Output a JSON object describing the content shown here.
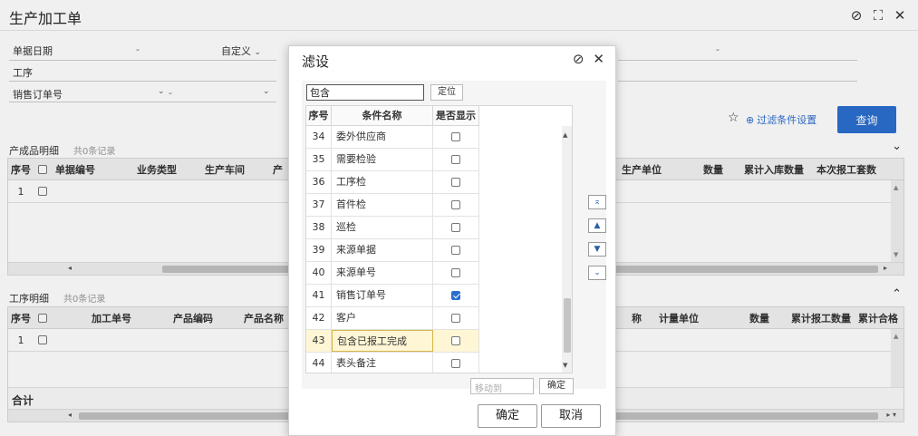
{
  "window": {
    "title": "生产加工单",
    "help_icon": "help-circle-icon",
    "maximize_icon": "maximize-icon",
    "close_icon": "close-icon"
  },
  "filters": {
    "doc_date_label": "单据日期",
    "doc_date_dash": "-",
    "custom_label": "自定义",
    "process_label": "工序",
    "sales_order_label": "销售订单号",
    "sales_order_dash": "-",
    "right_dash": "-",
    "filter_settings_label": "过滤条件设置",
    "query_label": "查询"
  },
  "products": {
    "title": "产成品明细",
    "count": "共0条记录",
    "columns": [
      "序号",
      "单据编号",
      "业务类型",
      "生产车间",
      "产"
    ],
    "right_columns": [
      "生产单位",
      "数量",
      "累计入库数量",
      "本次报工套数"
    ],
    "rows": [
      {
        "no": "1"
      }
    ]
  },
  "process_detail": {
    "title": "工序明细",
    "count": "共0条记录",
    "columns": [
      "序号",
      "加工单号",
      "产品编码",
      "产品名称"
    ],
    "right_columns": [
      "称",
      "计量单位",
      "数量",
      "累计报工数量",
      "累计合格"
    ],
    "rows": [
      {
        "no": "1"
      }
    ],
    "total_label": "合计"
  },
  "dialog": {
    "title": "滤设",
    "search_value": "包含",
    "locate_label": "定位",
    "columns": {
      "no": "序号",
      "name": "条件名称",
      "show": "是否显示"
    },
    "rows": [
      {
        "no": "34",
        "name": "委外供应商",
        "checked": false
      },
      {
        "no": "35",
        "name": "需要检验",
        "checked": false
      },
      {
        "no": "36",
        "name": "工序检",
        "checked": false
      },
      {
        "no": "37",
        "name": "首件检",
        "checked": false
      },
      {
        "no": "38",
        "name": "巡检",
        "checked": false
      },
      {
        "no": "39",
        "name": "来源单据",
        "checked": false
      },
      {
        "no": "40",
        "name": "来源单号",
        "checked": false
      },
      {
        "no": "41",
        "name": "销售订单号",
        "checked": true
      },
      {
        "no": "42",
        "name": "客户",
        "checked": false
      },
      {
        "no": "43",
        "name": "包含已报工完成",
        "checked": false,
        "selected": true
      },
      {
        "no": "44",
        "name": "表头备注",
        "checked": false
      }
    ],
    "move_to_placeholder": "移动到",
    "move_confirm_label": "确定",
    "ok_label": "确定",
    "cancel_label": "取消"
  }
}
